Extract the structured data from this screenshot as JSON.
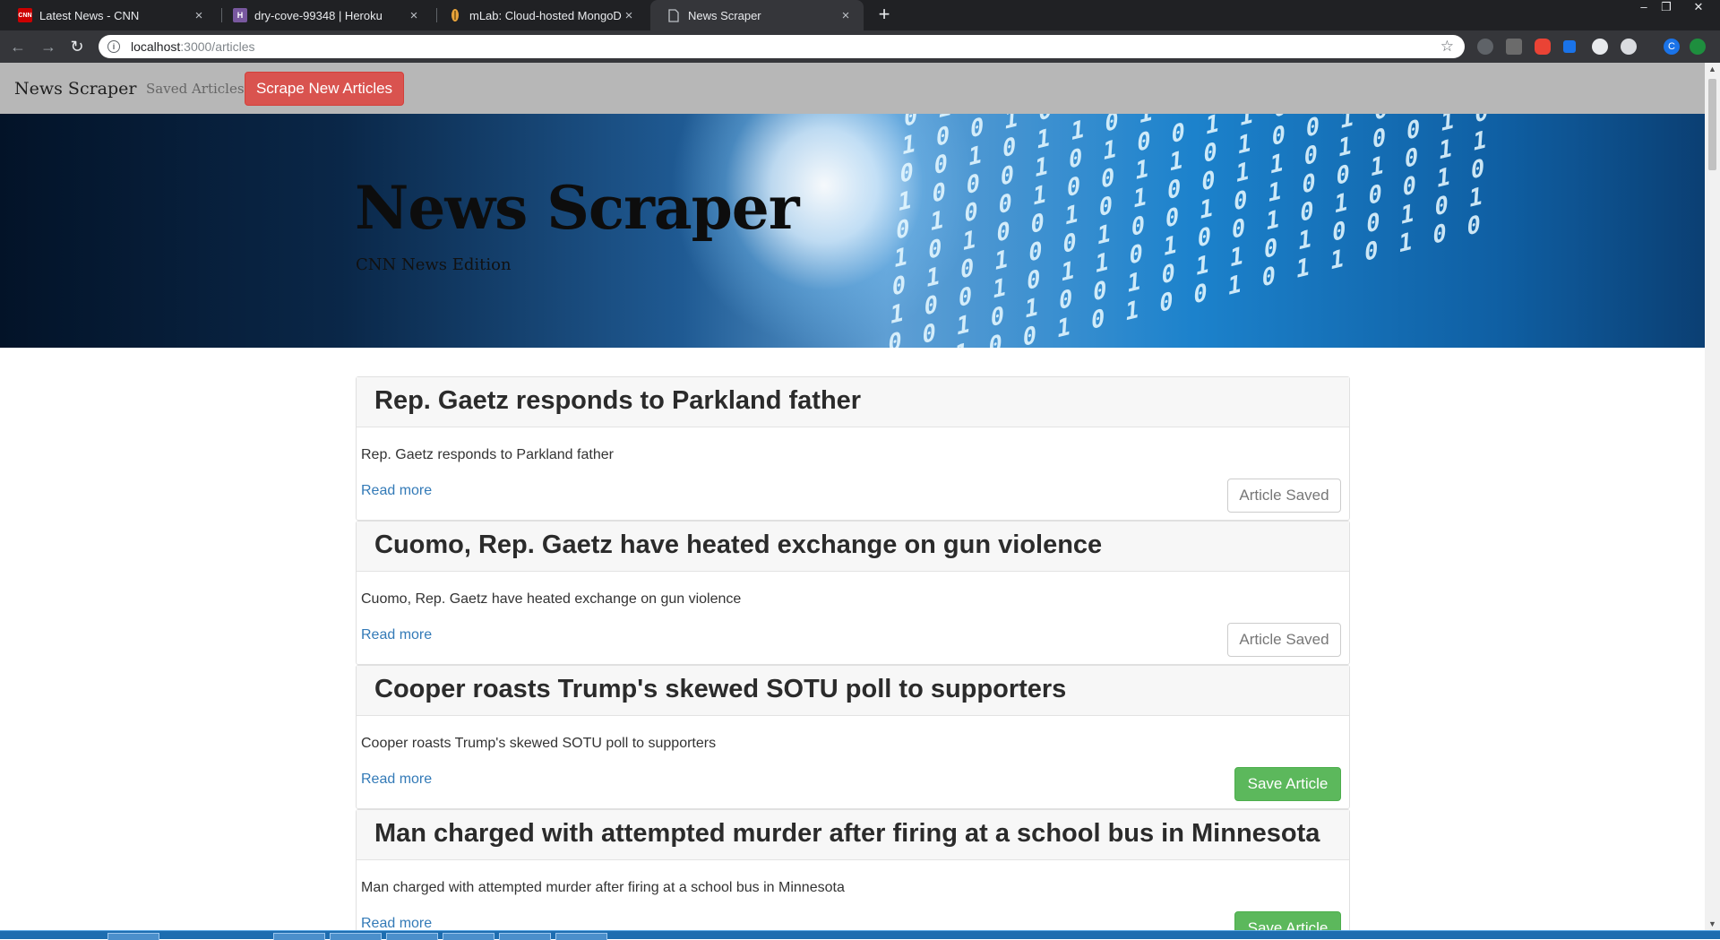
{
  "browser": {
    "tabs": [
      {
        "title": "Latest News - CNN",
        "icon": "cnn-favicon",
        "icon_text": "CNN",
        "color": "#cc0000",
        "active": false
      },
      {
        "title": "dry-cove-99348 | Heroku",
        "icon": "heroku-favicon",
        "icon_text": "H",
        "color": "#79589f",
        "active": false
      },
      {
        "title": "mLab: Cloud-hosted MongoDB",
        "icon": "mlab-favicon",
        "icon_text": "",
        "color": "#e8a33b",
        "active": false
      },
      {
        "title": "News Scraper",
        "icon": "page-favicon",
        "icon_text": "",
        "color": "#9aa0a6",
        "active": true
      }
    ],
    "close_glyph": "×",
    "new_tab_glyph": "+",
    "url_host": "localhost",
    "url_path": ":3000/articles",
    "extensions": [
      "#5f6368",
      "#6b6b6b",
      "#ea4335",
      "#1a73e8",
      "#e8eaed",
      "#dadce0",
      "#1a73e8",
      "#1e8e3e"
    ],
    "profile_initial": "C"
  },
  "site": {
    "brand": "News Scraper",
    "nav_saved": "Saved Articles",
    "scrape_button": "Scrape New Articles",
    "hero_title": "News Scraper",
    "hero_subtitle": "CNN News Edition"
  },
  "articles": [
    {
      "headline": "Rep. Gaetz responds to Parkland father",
      "summary": "Rep. Gaetz responds to Parkland father",
      "link": "Read more",
      "button": "Article Saved",
      "saved": true
    },
    {
      "headline": "Cuomo, Rep. Gaetz have heated exchange on gun violence",
      "summary": "Cuomo, Rep. Gaetz have heated exchange on gun violence",
      "link": "Read more",
      "button": "Article Saved",
      "saved": true
    },
    {
      "headline": "Cooper roasts Trump's skewed SOTU poll to supporters",
      "summary": "Cooper roasts Trump's skewed SOTU poll to supporters",
      "link": "Read more",
      "button": "Save Article",
      "saved": false
    },
    {
      "headline": "Man charged with attempted murder after firing at a school bus in Minnesota",
      "summary": "Man charged with attempted murder after firing at a school bus in Minnesota",
      "link": "Read more",
      "button": "Save Article",
      "saved": false
    }
  ]
}
